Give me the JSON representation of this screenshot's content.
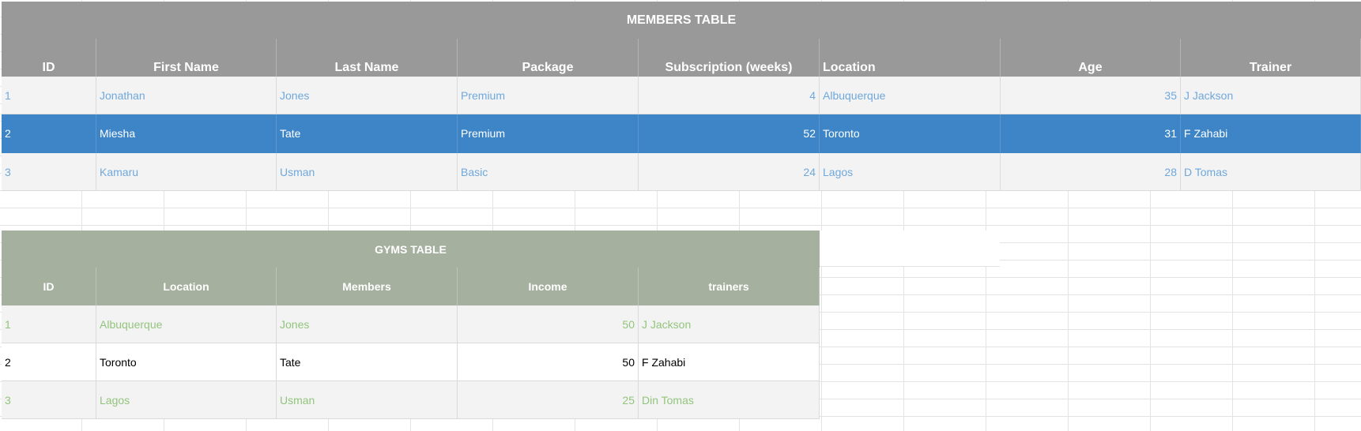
{
  "members_table": {
    "title": "MEMBERS TABLE",
    "headers": [
      "ID",
      "First Name",
      "Last Name",
      "Package",
      "Subscription (weeks)",
      "Location",
      "Age",
      "Trainer"
    ],
    "rows": [
      [
        "1",
        "Jonathan",
        "Jones",
        "Premium",
        "4",
        "Albuquerque",
        "35",
        "J Jackson"
      ],
      [
        "2",
        "Miesha",
        "Tate",
        "Premium",
        "52",
        "Toronto",
        "31",
        "F Zahabi"
      ],
      [
        "3",
        "Kamaru",
        "Usman",
        "Basic",
        "24",
        "Lagos",
        "28",
        "D Tomas"
      ]
    ],
    "selected_row": 2,
    "colors": {
      "header_bg": "#999999",
      "row_text": "#6fa8dc",
      "selected_bg": "#3d85c6"
    }
  },
  "gyms_table": {
    "title": "GYMS TABLE",
    "headers": [
      "ID",
      "Location",
      "Members",
      "Income",
      "trainers"
    ],
    "rows": [
      [
        "1",
        "Albuquerque",
        "Jones",
        "50",
        "J Jackson"
      ],
      [
        "2",
        "Toronto",
        "Tate",
        "50",
        "F Zahabi"
      ],
      [
        "3",
        "Lagos",
        "Usman",
        "25",
        "Din Tomas"
      ]
    ],
    "colors": {
      "header_bg": "#a5b09f",
      "row_text": "#93c47d"
    }
  }
}
